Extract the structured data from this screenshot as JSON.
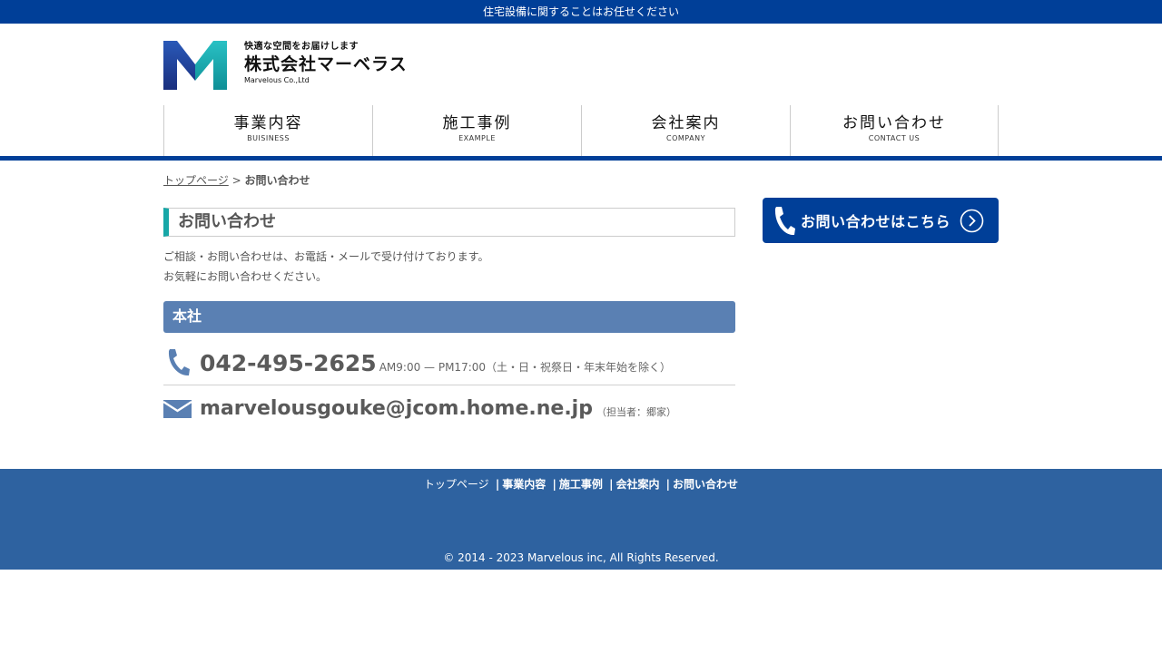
{
  "topbar": {
    "text": "住宅設備に関することはお任せください"
  },
  "logo": {
    "tagline": "快適な空間をお届けします",
    "name": "株式会社マーベラス",
    "english": "Marvelous Co.,Ltd",
    "colors": {
      "blue": "#1d3f94",
      "teal": "#17a7a7"
    }
  },
  "nav": [
    {
      "jp": "事業内容",
      "en": "BUISINESS"
    },
    {
      "jp": "施工事例",
      "en": "EXAMPLE"
    },
    {
      "jp": "会社案内",
      "en": "COMPANY"
    },
    {
      "jp": "お問い合わせ",
      "en": "CONTACT US"
    }
  ],
  "breadcrumb": {
    "home": "トップページ",
    "separator": ">",
    "current": "お問い合わせ"
  },
  "main": {
    "heading": "お問い合わせ",
    "lead_line1": "ご相談・お問い合わせは、お電話・メールで受け付けております。",
    "lead_line2": "お気軽にお問い合わせください。",
    "office_heading": "本社",
    "tel": {
      "number": "042-495-2625",
      "hours": "AM9:00 — PM17:00（土・日・祝祭日・年末年始を除く）",
      "icon": "phone-icon"
    },
    "mail": {
      "address": "marvelousgouke@jcom.home.ne.jp",
      "note": "（担当者：郷家）",
      "icon": "mail-icon"
    }
  },
  "side": {
    "cta_label": "お問い合わせはこちら",
    "cta_icon": "phone-icon",
    "arrow_icon": "chevron-right-circle-icon"
  },
  "footer": {
    "links": [
      "トップページ",
      "事業内容",
      "施工事例",
      "会社案内",
      "お問い合わせ"
    ],
    "separator": "|",
    "copyright": "© 2014 - 2023 Marvelous inc, All Rights Reserved."
  },
  "colors": {
    "primary": "#003f98",
    "accent_teal": "#17a7a7",
    "section_blue": "#5a80b3",
    "footer_blue": "#2e62a0"
  }
}
